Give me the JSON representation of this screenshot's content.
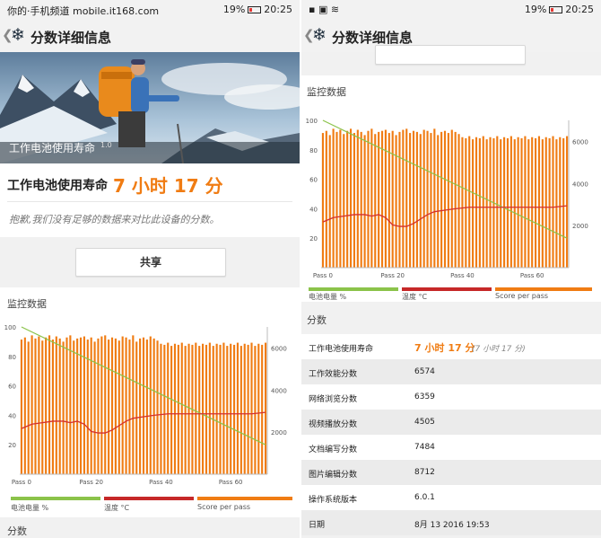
{
  "left": {
    "status": {
      "left_text": "你的·手机频道 mobile.it168.com",
      "battery": "19%",
      "time": "20:25"
    },
    "header": {
      "title": "分数详细信息",
      "back_glyph": "❮",
      "logo_icon": "snowflake-icon"
    },
    "hero": {
      "label": "工作电池使用寿命",
      "version": "1.0"
    },
    "result": {
      "label": "工作电池使用寿命",
      "value": "7 小时 17 分"
    },
    "notice": "抱歉,我们没有足够的数据来对比此设备的分数。",
    "share_button": "共享",
    "monitor": {
      "title": "监控数据",
      "legend": [
        "电池电量 %",
        "温度 °C",
        "Score per pass"
      ]
    },
    "scores_title": "分数"
  },
  "right": {
    "status": {
      "battery": "19%",
      "time": "20:25"
    },
    "header": {
      "title": "分数详细信息",
      "back_glyph": "❮",
      "logo_icon": "snowflake-icon"
    },
    "monitor": {
      "title": "监控数据",
      "legend": [
        "电池电量 %",
        "温度 °C",
        "Score per pass"
      ]
    },
    "scores_title": "分数",
    "scores": [
      {
        "label": "工作电池使用寿命",
        "value": "7 小时 17 分",
        "extra": "(7 小时 17 分)"
      },
      {
        "label": "工作效能分数",
        "value": "6574"
      },
      {
        "label": "网络浏览分数",
        "value": "6359"
      },
      {
        "label": "视频播放分数",
        "value": "4505"
      },
      {
        "label": "文档编写分数",
        "value": "7484"
      },
      {
        "label": "图片编辑分数",
        "value": "8712"
      },
      {
        "label": "操作系统版本",
        "value": "6.0.1"
      },
      {
        "label": "日期",
        "value": "8月 13 2016 19:53"
      }
    ]
  },
  "colors": {
    "accent": "#f07c13",
    "battery_line": "#8bc34a",
    "temp_line": "#d32f2f",
    "bars": "#f07c13"
  },
  "chart_data": [
    {
      "type": "bar",
      "title": "",
      "x": [
        0,
        1,
        2,
        3,
        4,
        5,
        6,
        7,
        8,
        9,
        10,
        11,
        12,
        13,
        14,
        15,
        16,
        17,
        18,
        19,
        20,
        21,
        22,
        23,
        24,
        25,
        26,
        27,
        28,
        29,
        30,
        31,
        32,
        33,
        34,
        35,
        36,
        37,
        38,
        39,
        40,
        41,
        42,
        43,
        44,
        45,
        46,
        47,
        48,
        49,
        50,
        51,
        52,
        53,
        54,
        55,
        56,
        57,
        58,
        59,
        60,
        61,
        62,
        63,
        64,
        65,
        66,
        67,
        68,
        69,
        70
      ],
      "x_ticks": [
        "Pass 0",
        "Pass 20",
        "Pass 40",
        "Pass 60"
      ],
      "y_left_ticks": [
        20,
        40,
        60,
        80,
        100
      ],
      "y_right_ticks": [
        2000,
        4000,
        6000
      ],
      "ylim_left": [
        0,
        100
      ],
      "ylim_right": [
        0,
        7000
      ],
      "grid": false,
      "series": [
        {
          "name": "Score per pass",
          "axis": "right",
          "values": [
            6400,
            6500,
            6300,
            6600,
            6450,
            6550,
            6350,
            6500,
            6600,
            6400,
            6550,
            6450,
            6300,
            6500,
            6600,
            6350,
            6450,
            6500,
            6550,
            6400,
            6500,
            6300,
            6450,
            6550,
            6600,
            6400,
            6500,
            6450,
            6350,
            6550,
            6500,
            6400,
            6600,
            6300,
            6450,
            6500,
            6400,
            6550,
            6450,
            6350,
            6200,
            6150,
            6250,
            6100,
            6200,
            6150,
            6250,
            6100,
            6200,
            6150,
            6250,
            6100,
            6200,
            6150,
            6250,
            6100,
            6200,
            6150,
            6250,
            6100,
            6200,
            6150,
            6250,
            6100,
            6200,
            6150,
            6250,
            6100,
            6200,
            6150,
            6250
          ]
        },
        {
          "name": "电池电量 %",
          "axis": "left",
          "x": [
            0,
            70
          ],
          "values": [
            100,
            20
          ]
        },
        {
          "name": "温度 °C",
          "axis": "left",
          "x": [
            0,
            3,
            6,
            9,
            12,
            14,
            16,
            18,
            20,
            22,
            24,
            26,
            28,
            30,
            32,
            35,
            38,
            42,
            50,
            60,
            66,
            70
          ],
          "values": [
            31,
            34,
            35,
            36,
            36,
            35,
            36,
            34,
            29,
            28,
            28,
            30,
            33,
            36,
            38,
            39,
            40,
            41,
            41,
            41,
            41,
            42
          ]
        }
      ]
    },
    {
      "type": "bar",
      "title": "",
      "x_ticks": [
        "Pass 0",
        "Pass 20",
        "Pass 40",
        "Pass 60"
      ],
      "y_left_ticks": [
        20,
        40,
        60,
        80,
        100
      ],
      "y_right_ticks": [
        2000,
        4000,
        6000
      ],
      "ylim_left": [
        0,
        100
      ],
      "ylim_right": [
        0,
        7000
      ],
      "grid": false,
      "same_series_as": 0
    }
  ]
}
